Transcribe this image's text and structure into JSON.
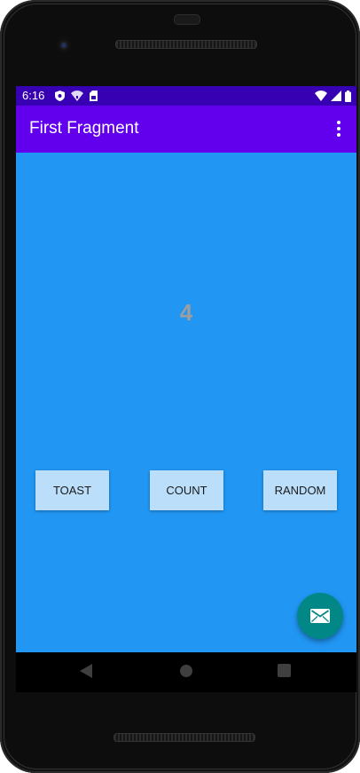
{
  "status_bar": {
    "time": "6:16",
    "left_icons": [
      "shield-icon",
      "wifi-question-icon",
      "sim-card-icon"
    ],
    "right_icons": [
      "wifi-icon",
      "signal-icon",
      "battery-icon"
    ]
  },
  "app_bar": {
    "title": "First Fragment",
    "menu_icon": "more-vert-icon"
  },
  "main": {
    "counter_value": "4",
    "buttons": {
      "toast": "TOAST",
      "count": "COUNT",
      "random": "RANDOM"
    },
    "fab_icon": "email-icon"
  },
  "navigation": {
    "back_icon": "back-triangle-icon",
    "home_icon": "home-circle-icon",
    "recents_icon": "recents-square-icon"
  },
  "colors": {
    "status_bar": "#3700b3",
    "app_bar": "#6200ee",
    "background": "#2196f3",
    "button": "#bbdefb",
    "fab": "#018786",
    "counter_text": "#9e9e9e"
  }
}
